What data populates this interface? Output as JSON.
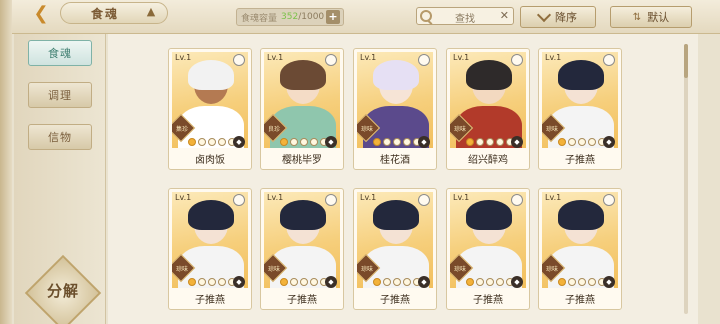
{
  "header": {
    "title": "食魂",
    "capacity_label": "食魂容量",
    "capacity_current": "352",
    "capacity_total": "/1000",
    "search_placeholder": "查找",
    "sort_label": "降序",
    "filter_label": "默认"
  },
  "sidebar": {
    "items": [
      {
        "label": "食魂",
        "active": true
      },
      {
        "label": "调理",
        "active": false
      },
      {
        "label": "信物",
        "active": false
      }
    ],
    "decompose_label": "分解"
  },
  "cards": [
    {
      "level": "Lv.1",
      "name": "卤肉饭",
      "rarity": "集珍",
      "hair": "#f2f2f2",
      "skin": "#b47a52",
      "body": "#ffffff",
      "stars_filled": 1
    },
    {
      "level": "Lv.1",
      "name": "樱桃毕罗",
      "rarity": "良珍",
      "hair": "#6b4a34",
      "skin": "#f4dcc6",
      "body": "#8fc6ad",
      "stars_filled": 1
    },
    {
      "level": "Lv.1",
      "name": "桂花酒",
      "rarity": "琼味",
      "hair": "#e6e0f4",
      "skin": "#f6e4d6",
      "body": "#5b4a8c",
      "stars_filled": 1
    },
    {
      "level": "Lv.1",
      "name": "绍兴醉鸡",
      "rarity": "琼味",
      "hair": "#2e2a2a",
      "skin": "#f3d9c0",
      "body": "#b23a2a",
      "stars_filled": 1
    },
    {
      "level": "Lv.1",
      "name": "子推燕",
      "rarity": "琼味",
      "hair": "#23283c",
      "skin": "#f4e2d4",
      "body": "#f4f4f4",
      "stars_filled": 1
    },
    {
      "level": "Lv.1",
      "name": "子推燕",
      "rarity": "琼味",
      "hair": "#23283c",
      "skin": "#f4e2d4",
      "body": "#f4f4f4",
      "stars_filled": 1
    },
    {
      "level": "Lv.1",
      "name": "子推燕",
      "rarity": "琼味",
      "hair": "#23283c",
      "skin": "#f4e2d4",
      "body": "#f4f4f4",
      "stars_filled": 1
    },
    {
      "level": "Lv.1",
      "name": "子推燕",
      "rarity": "琼味",
      "hair": "#23283c",
      "skin": "#f4e2d4",
      "body": "#f4f4f4",
      "stars_filled": 1
    },
    {
      "level": "Lv.1",
      "name": "子推燕",
      "rarity": "琼味",
      "hair": "#23283c",
      "skin": "#f4e2d4",
      "body": "#f4f4f4",
      "stars_filled": 1
    },
    {
      "level": "Lv.1",
      "name": "子推燕",
      "rarity": "琼味",
      "hair": "#23283c",
      "skin": "#f4e2d4",
      "body": "#f4f4f4",
      "stars_filled": 1
    }
  ],
  "colors": {
    "accent": "#c98a2c",
    "active_tab": "#3e7e70",
    "capacity_number": "#7cc24a"
  }
}
